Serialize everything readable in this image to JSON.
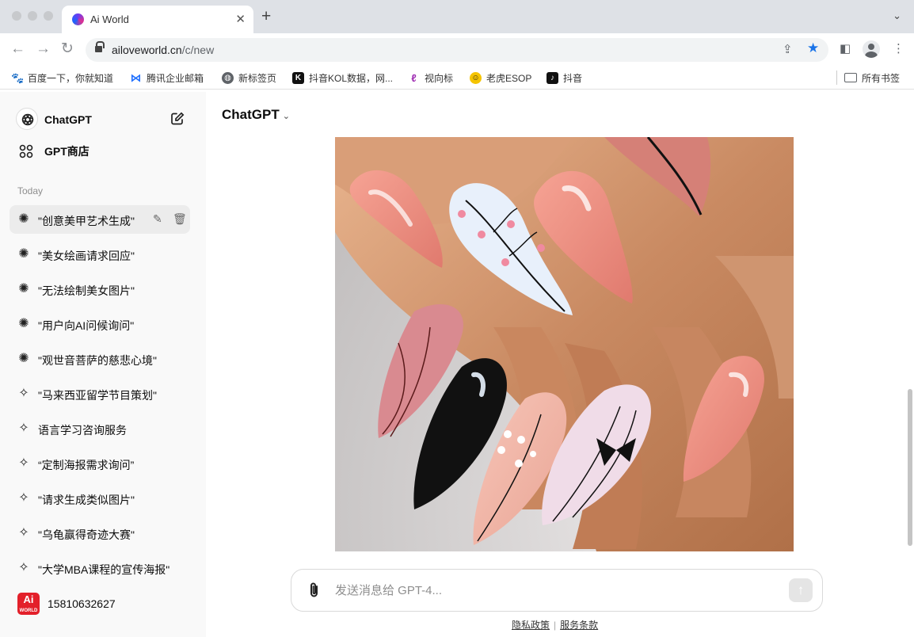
{
  "browser": {
    "tab_title": "Ai World",
    "url_host": "ailoveworld.cn",
    "url_path": "/c/new",
    "bookmarks": [
      {
        "label": "百度一下，你就知道",
        "icon": "baidu-icon",
        "color": "#2932e1"
      },
      {
        "label": "腾讯企业邮箱",
        "icon": "tencent-mail-icon",
        "color": "#1e6fff"
      },
      {
        "label": "新标签页",
        "icon": "globe-icon",
        "color": "#5f6368"
      },
      {
        "label": "抖音KOL数据，网...",
        "icon": "k-logo-icon",
        "color": "#111111"
      },
      {
        "label": "视向标",
        "icon": "feather-icon",
        "color": "#9c27b0"
      },
      {
        "label": "老虎ESOP",
        "icon": "tiger-icon",
        "color": "#f5c400"
      },
      {
        "label": "抖音",
        "icon": "tiktok-icon",
        "color": "#111111"
      }
    ],
    "all_bookmarks": "所有书签"
  },
  "sidebar": {
    "app_name": "ChatGPT",
    "store_label": "GPT商店",
    "section_today": "Today",
    "chats": [
      {
        "label": "\"创意美甲艺术生成\"",
        "icon": "openai-icon",
        "active": true
      },
      {
        "label": "\"美女绘画请求回应\"",
        "icon": "openai-icon"
      },
      {
        "label": "\"无法绘制美女图片\"",
        "icon": "openai-icon"
      },
      {
        "label": "\"用户向AI问候询问\"",
        "icon": "openai-icon"
      },
      {
        "label": "\"观世音菩萨的慈悲心境\"",
        "icon": "openai-icon"
      },
      {
        "label": "\"马来西亚留学节目策划\"",
        "icon": "sparkle-icon"
      },
      {
        "label": "语言学习咨询服务",
        "icon": "sparkle-icon"
      },
      {
        "label": "“定制海报需求询问”",
        "icon": "sparkle-icon"
      },
      {
        "label": "\"请求生成类似图片\"",
        "icon": "sparkle-icon"
      },
      {
        "label": "\"乌龟赢得奇迹大赛\"",
        "icon": "sparkle-icon"
      },
      {
        "label": "\"大学MBA课程的宣传海报\"",
        "icon": "sparkle-icon"
      }
    ],
    "user": {
      "logo_text": "Ai",
      "logo_sub": "WORLD",
      "name": "15810632627"
    }
  },
  "main": {
    "model": "ChatGPT",
    "image_alt": "Manicured hand with long stiletto nails in pink, white floral, black and bow designs",
    "composer_placeholder": "发送消息给 GPT-4...",
    "footer": {
      "privacy": "隐私政策",
      "terms": "服务条款"
    }
  },
  "colors": {
    "accent_star": "#1a73e8",
    "brand_red": "#e3202a"
  }
}
